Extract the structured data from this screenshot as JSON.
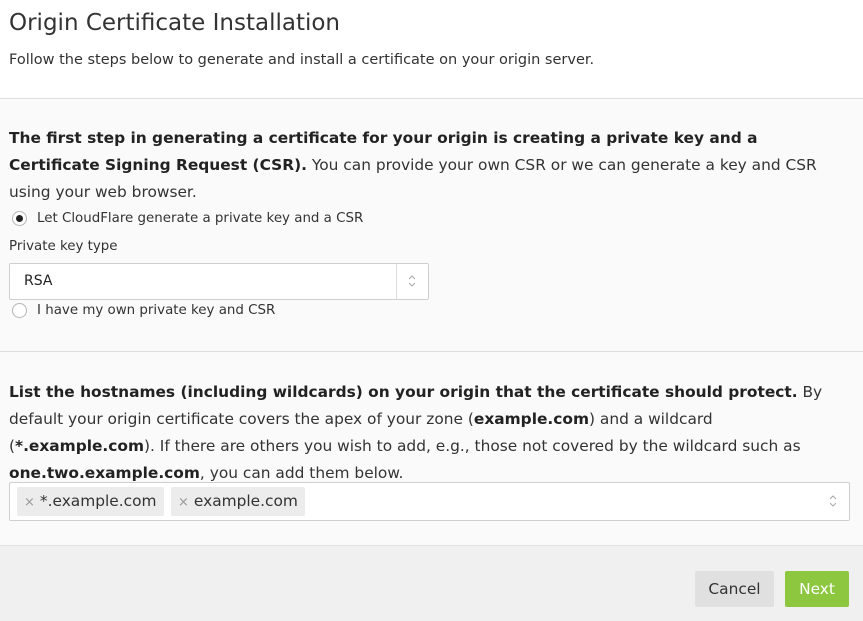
{
  "page": {
    "title": "Origin Certificate Installation",
    "subtitle": "Follow the steps below to generate and install a certificate on your origin server."
  },
  "step_one": {
    "intro_bold": "The first step in generating a certificate for your origin is creating a private key and a Certificate Signing Request (CSR).",
    "intro_text": " You can provide your own CSR or we can generate a key and CSR using your web browser.",
    "option_generate": "Let CloudFlare generate a private key and a CSR",
    "option_generate_selected": true,
    "key_type_label": "Private key type",
    "key_type_value": "RSA",
    "option_own": "I have my own private key and CSR",
    "option_own_selected": false
  },
  "step_two": {
    "intro_bold": "List the hostnames (including wildcards) on your origin that the certificate should protect.",
    "text_1": " By default your origin certificate covers the apex of your zone (",
    "apex": "example.com",
    "text_2": ") and a wildcard (",
    "wildcard": "*.example.com",
    "text_3": "). If there are others you wish to add, e.g., those not covered by the wildcard such as ",
    "example_sub": "one.two.example.com",
    "text_4": ", you can add them below.",
    "hostnames": [
      "*.example.com",
      "example.com"
    ],
    "remove_glyph": "×"
  },
  "footer": {
    "cancel_label": "Cancel",
    "next_label": "Next"
  },
  "colors": {
    "next_button": "#8dc63f",
    "section_bg": "#fafafa",
    "footer_bg": "#f0f0f0"
  },
  "icons": {
    "select_arrows": "up-down-chevron-icon",
    "tag_remove": "close-icon"
  }
}
